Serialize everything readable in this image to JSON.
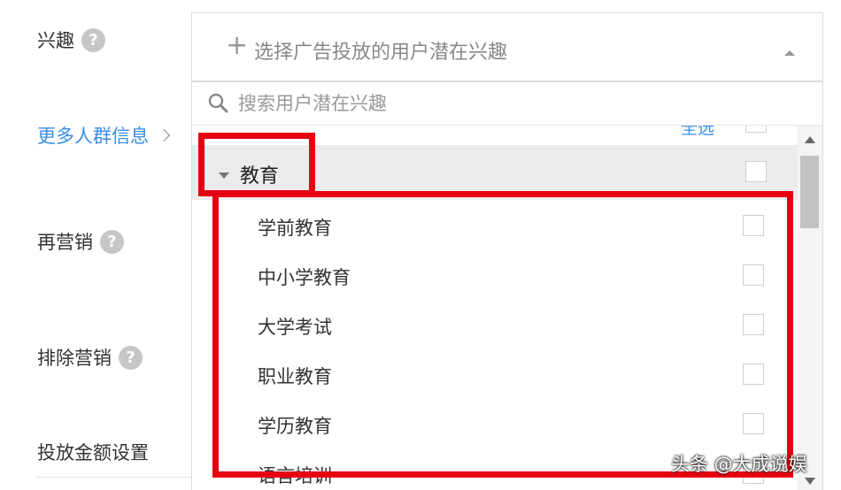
{
  "form": {
    "interest_label": "兴趣",
    "more_info_label": "更多人群信息",
    "remarketing_label": "再营销",
    "exclude_label": "排除营销",
    "budget_label": "投放金额设置",
    "help_glyph": "?"
  },
  "picker": {
    "plus_glyph": "+",
    "placeholder": "选择广告投放的用户潜在兴趣"
  },
  "search": {
    "placeholder": "搜索用户潜在兴趣"
  },
  "list": {
    "select_all": "全选",
    "group": {
      "label": "教育",
      "expanded": true
    },
    "items": [
      {
        "label": "学前教育"
      },
      {
        "label": "中小学教育"
      },
      {
        "label": "大学考试"
      },
      {
        "label": "职业教育"
      },
      {
        "label": "学历教育"
      },
      {
        "label": "语言培训"
      }
    ]
  },
  "watermark": {
    "text": "头条 @大成说娱"
  },
  "colors": {
    "highlight": "#e60012",
    "link": "#3a8ee6",
    "group_bg": "#ececec"
  },
  "icons": {
    "help": "question-circle-icon",
    "search": "magnifier-icon",
    "expand": "caret-down-icon",
    "picker_toggle": "caret-up-icon"
  }
}
